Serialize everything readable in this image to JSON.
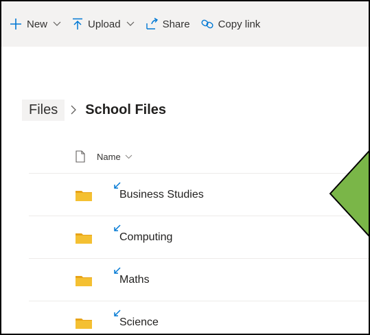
{
  "toolbar": {
    "new_label": "New",
    "upload_label": "Upload",
    "share_label": "Share",
    "copy_link_label": "Copy link"
  },
  "breadcrumb": {
    "root": "Files",
    "current": "School Files"
  },
  "list": {
    "header_name": "Name",
    "items": [
      {
        "name": "Business Studies",
        "icon": "folder-shortcut-icon"
      },
      {
        "name": "Computing",
        "icon": "folder-shortcut-icon"
      },
      {
        "name": "Maths",
        "icon": "folder-shortcut-icon"
      },
      {
        "name": "Science",
        "icon": "folder-shortcut-icon"
      }
    ]
  },
  "colors": {
    "accent": "#0078d4",
    "folder": "#f4c032",
    "folder_dark": "#e8a317",
    "arrow_fill": "#7ab648",
    "toolbar_bg": "#f3f2f1"
  }
}
